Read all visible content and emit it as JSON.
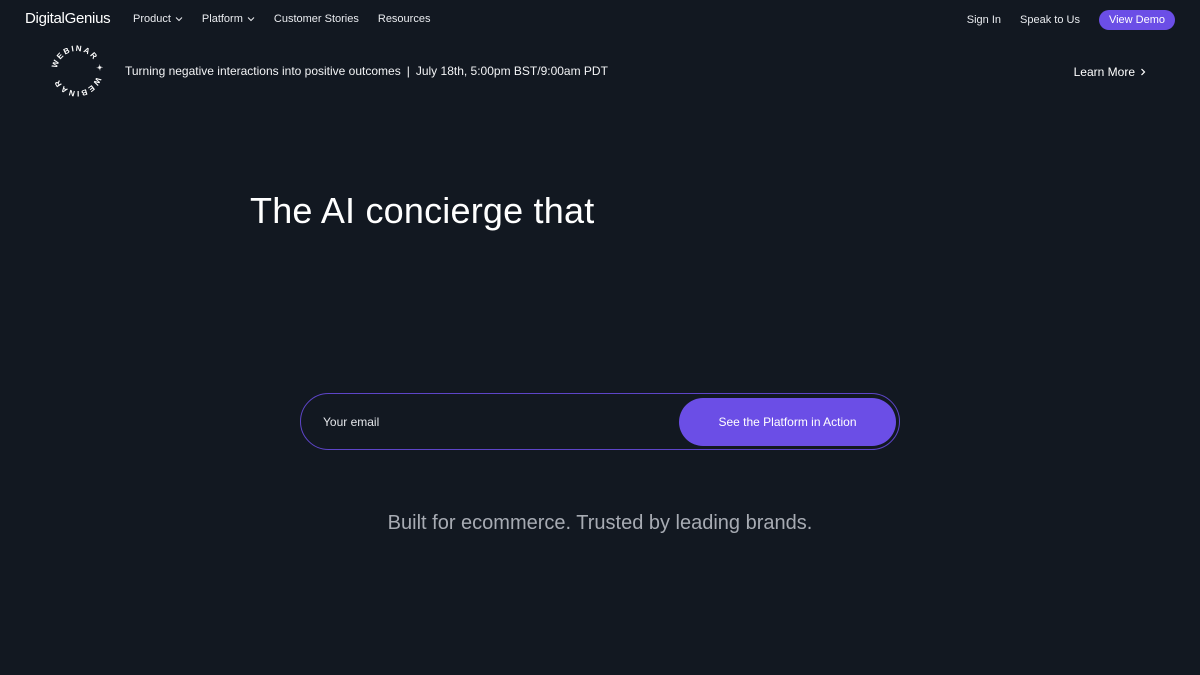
{
  "nav": {
    "logo": "DigitalGenius",
    "links": [
      {
        "label": "Product",
        "dropdown": true
      },
      {
        "label": "Platform",
        "dropdown": true
      },
      {
        "label": "Customer Stories",
        "dropdown": false
      },
      {
        "label": "Resources",
        "dropdown": false
      }
    ],
    "sign_in": "Sign In",
    "speak_to_us": "Speak to Us",
    "view_demo": "View Demo"
  },
  "banner": {
    "badge_text": "WEBINAR",
    "title": "Turning negative interactions into positive outcomes",
    "separator": "|",
    "date": "July 18th, 5:00pm BST/9:00am PDT",
    "learn_more": "Learn More"
  },
  "hero": {
    "title": "The AI concierge that",
    "email_placeholder": "Your email",
    "cta_label": "See the Platform in Action",
    "tagline": "Built for ecommerce. Trusted by leading brands."
  },
  "colors": {
    "background": "#121821",
    "accent": "#6b4ee6",
    "tagline": "#a7abb3"
  }
}
